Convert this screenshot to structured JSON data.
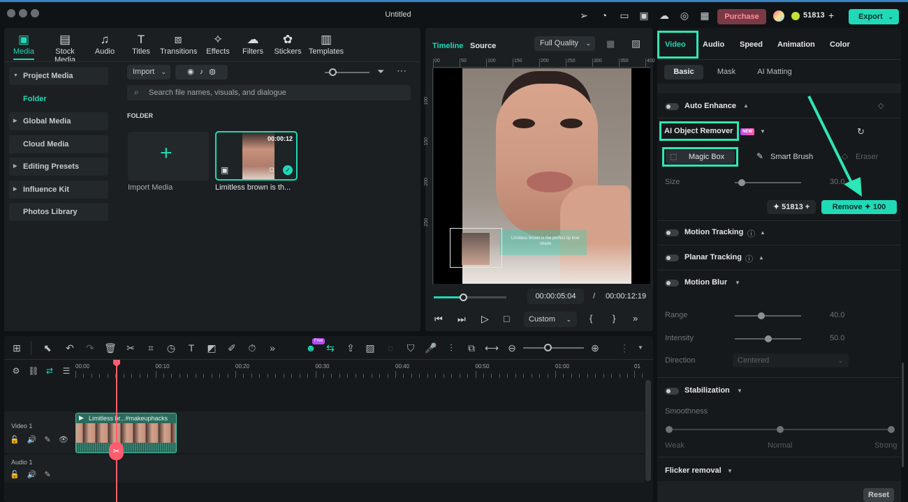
{
  "window": {
    "title": "Untitled"
  },
  "topbar": {
    "purchase_label": "Purchase",
    "credits": "51813",
    "export_label": "Export"
  },
  "media_tabs": [
    {
      "label": "Media",
      "icon": "media-icon"
    },
    {
      "label": "Stock Media",
      "icon": "stock-media-icon"
    },
    {
      "label": "Audio",
      "icon": "music-icon"
    },
    {
      "label": "Titles",
      "icon": "titles-icon"
    },
    {
      "label": "Transitions",
      "icon": "transitions-icon"
    },
    {
      "label": "Effects",
      "icon": "effects-icon"
    },
    {
      "label": "Filters",
      "icon": "filters-icon"
    },
    {
      "label": "Stickers",
      "icon": "stickers-icon"
    },
    {
      "label": "Templates",
      "icon": "templates-icon"
    }
  ],
  "sidebar": {
    "items": [
      {
        "label": "Project Media"
      },
      {
        "label": "Folder"
      },
      {
        "label": "Global Media"
      },
      {
        "label": "Cloud Media"
      },
      {
        "label": "Editing Presets"
      },
      {
        "label": "Influence Kit"
      },
      {
        "label": "Photos Library"
      }
    ]
  },
  "library": {
    "import_label": "Import",
    "search_placeholder": "Search file names, visuals, and dialogue",
    "folder_heading": "FOLDER",
    "import_media_label": "Import Media",
    "clip_label": "Limitless brown is th...",
    "clip_duration": "00:00:12"
  },
  "preview": {
    "tab_timeline": "Timeline",
    "tab_source": "Source",
    "quality": "Full Quality",
    "ruler_top": [
      "00",
      "50",
      "100",
      "150",
      "200",
      "250",
      "300",
      "350",
      "400"
    ],
    "ruler_left": [
      "100",
      "150",
      "200",
      "250"
    ],
    "current_time": "00:00:05:04",
    "time_sep": "/",
    "total_time": "00:00:12:19",
    "playback_progress": 0.4,
    "zoom_label": "Custom",
    "overlay_text": "Limitless brown is the perfect lip liner shade"
  },
  "props": {
    "tabs": [
      "Video",
      "Audio",
      "Speed",
      "Animation",
      "Color"
    ],
    "subtabs": [
      "Basic",
      "Mask",
      "AI Matting"
    ],
    "auto_enhance": "Auto Enhance",
    "ai_object_remover": "AI Object Remover",
    "new_badge": "NEW",
    "magic_box": "Magic Box",
    "smart_brush": "Smart Brush",
    "eraser": "Eraser",
    "size_label": "Size",
    "size_value": "30.0",
    "size_level": 0.1,
    "credits": "51813",
    "remove_label": "Remove",
    "remove_cost": "100",
    "motion_tracking": "Motion Tracking",
    "planar_tracking": "Planar Tracking",
    "motion_blur": "Motion Blur",
    "range_label": "Range",
    "range_value": "40.0",
    "range_level": 0.4,
    "intensity_label": "Intensity",
    "intensity_value": "50.0",
    "intensity_level": 0.5,
    "direction_label": "Direction",
    "direction_value": "Centered",
    "stabilization": "Stabilization",
    "smoothness_label": "Smoothness",
    "smooth_weak": "Weak",
    "smooth_normal": "Normal",
    "smooth_strong": "Strong",
    "flicker_removal": "Flicker removal",
    "reset_label": "Reset"
  },
  "timeline": {
    "ruler": [
      "00:00",
      "00:10",
      "00:20",
      "00:30",
      "00:40",
      "00:50",
      "01:00",
      "01"
    ],
    "free_badge": "Free",
    "video_track": "Video 1",
    "audio_track": "Audio 1",
    "clip_title": "Limitless br...#makeuphacks"
  },
  "colors": {
    "accent": "#20d9b7",
    "purchase": "#7a3a44",
    "annotation": "#2ee6b6"
  }
}
